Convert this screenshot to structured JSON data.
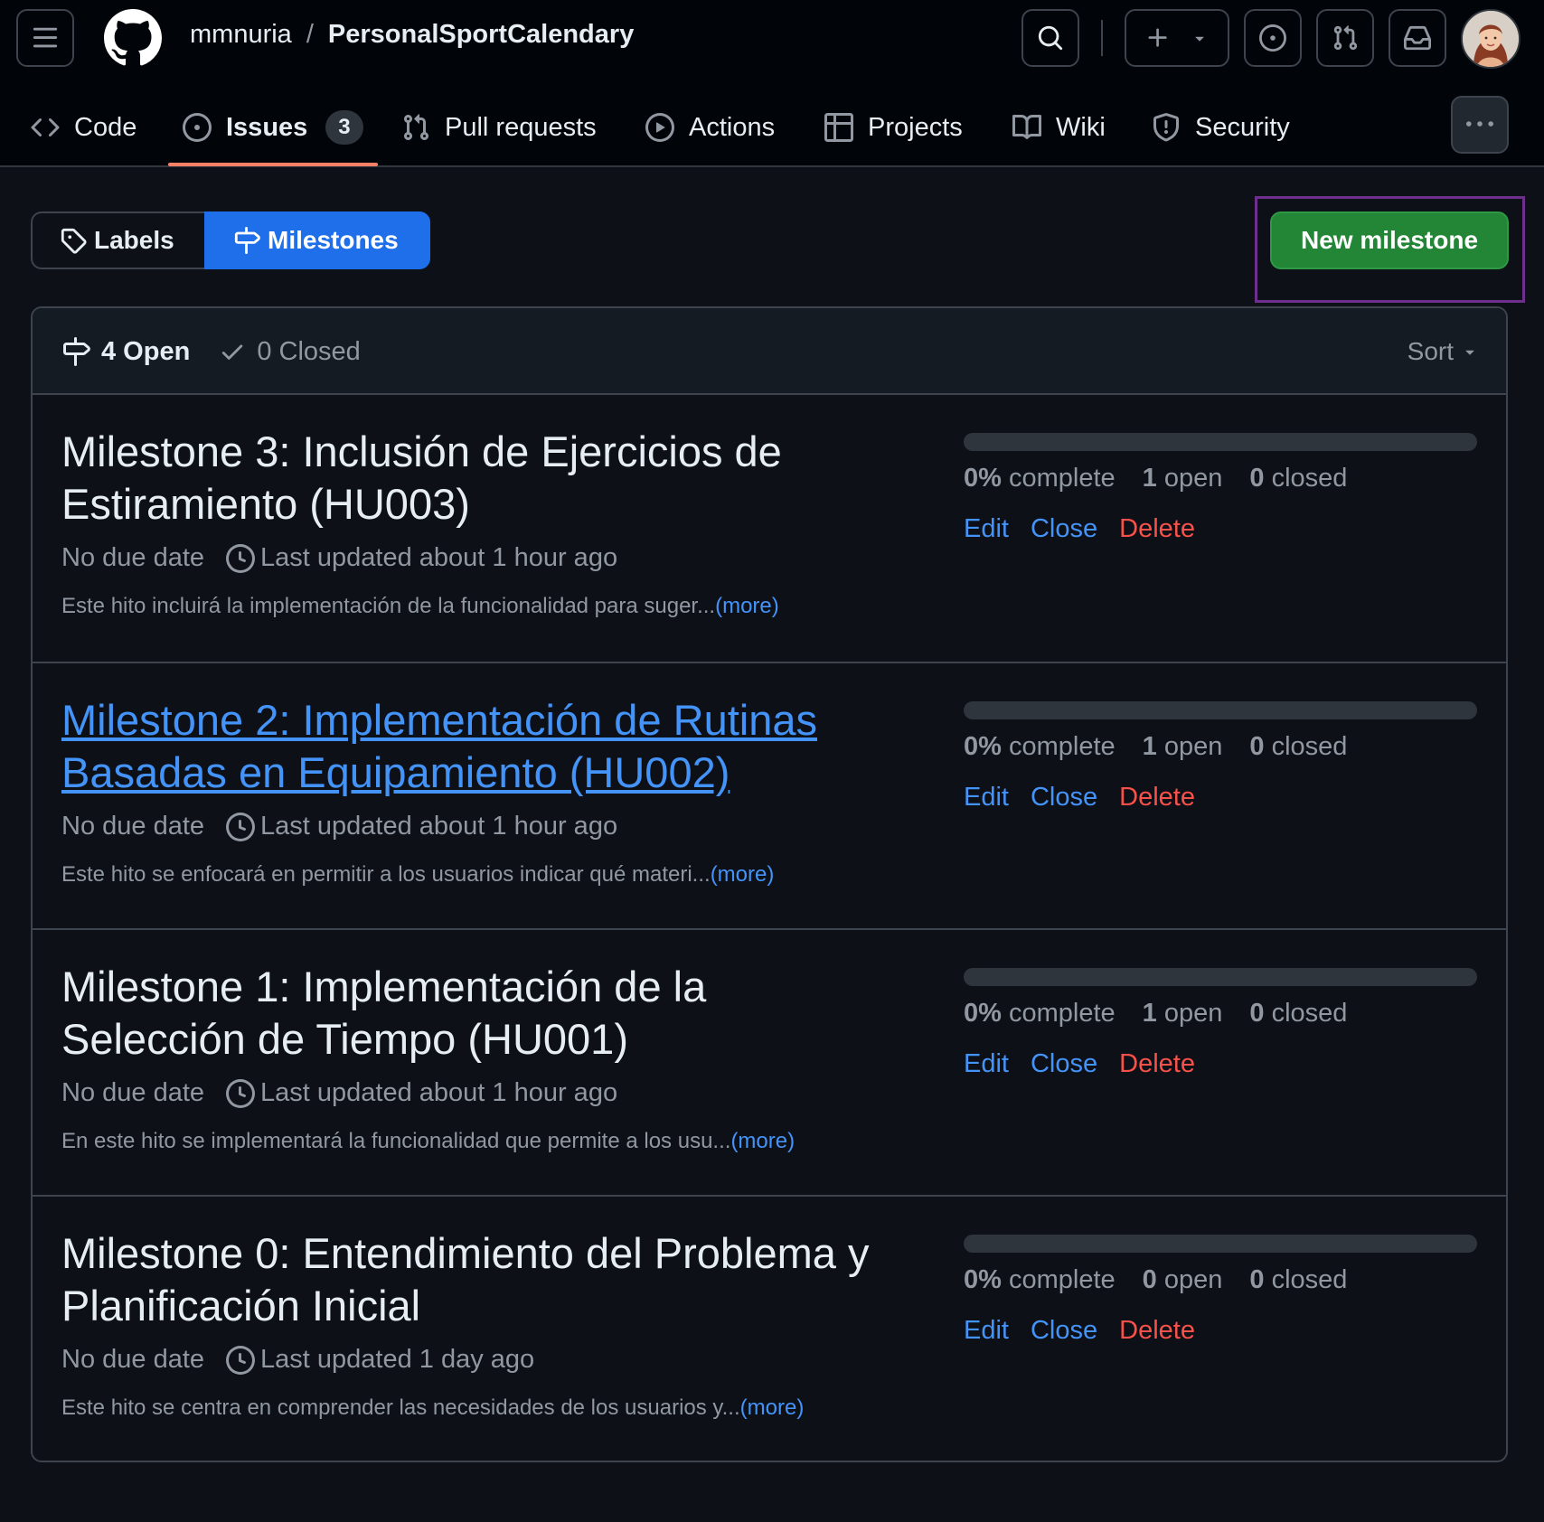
{
  "header": {
    "owner": "mmnuria",
    "separator": "/",
    "repo": "PersonalSportCalendary"
  },
  "repo_nav": {
    "items": [
      {
        "label": "Code",
        "icon": "code-icon"
      },
      {
        "label": "Issues",
        "icon": "issue-opened-icon",
        "counter": "3",
        "active": true
      },
      {
        "label": "Pull requests",
        "icon": "git-pull-request-icon"
      },
      {
        "label": "Actions",
        "icon": "play-icon"
      },
      {
        "label": "Projects",
        "icon": "table-icon"
      },
      {
        "label": "Wiki",
        "icon": "book-icon"
      },
      {
        "label": "Security",
        "icon": "shield-icon"
      }
    ]
  },
  "subnav": {
    "labels": "Labels",
    "milestones": "Milestones",
    "new_milestone": "New milestone"
  },
  "states": {
    "open": "4 Open",
    "closed": "0 Closed",
    "sort": "Sort"
  },
  "milestones": [
    {
      "title": "Milestone 3: Inclusión de Ejercicios de Estiramiento (HU003)",
      "due": "No due date",
      "updated": "Last updated about 1 hour ago",
      "description": "Este hito incluirá la implementación de la funcionalidad para suger...",
      "more": "(more)",
      "percent": "0%",
      "percent_label": "complete",
      "open_count": "1",
      "open_label": "open",
      "closed_count": "0",
      "closed_label": "closed",
      "progress": 0,
      "edit": "Edit",
      "close": "Close",
      "delete": "Delete"
    },
    {
      "title": "Milestone 2: Implementación de Rutinas Basadas en Equipamiento (HU002)",
      "due": "No due date",
      "updated": "Last updated about 1 hour ago",
      "description": "Este hito se enfocará en permitir a los usuarios indicar qué materi...",
      "more": "(more)",
      "percent": "0%",
      "percent_label": "complete",
      "open_count": "1",
      "open_label": "open",
      "closed_count": "0",
      "closed_label": "closed",
      "progress": 0,
      "edit": "Edit",
      "close": "Close",
      "delete": "Delete"
    },
    {
      "title": "Milestone 1: Implementación de la Selección de Tiempo (HU001)",
      "due": "No due date",
      "updated": "Last updated about 1 hour ago",
      "description": "En este hito se implementará la funcionalidad que permite a los usu...",
      "more": "(more)",
      "percent": "0%",
      "percent_label": "complete",
      "open_count": "1",
      "open_label": "open",
      "closed_count": "0",
      "closed_label": "closed",
      "progress": 0,
      "edit": "Edit",
      "close": "Close",
      "delete": "Delete"
    },
    {
      "title": "Milestone 0: Entendimiento del Problema y Planificación Inicial",
      "due": "No due date",
      "updated": "Last updated 1 day ago",
      "description": "Este hito se centra en comprender las necesidades de los usuarios y...",
      "more": "(more)",
      "percent": "0%",
      "percent_label": "complete",
      "open_count": "0",
      "open_label": "open",
      "closed_count": "0",
      "closed_label": "closed",
      "progress": 0,
      "edit": "Edit",
      "close": "Close",
      "delete": "Delete"
    }
  ],
  "colors": {
    "background": "#0d1117",
    "header_bg": "#010409",
    "accent_blue": "#1f6feb",
    "link_blue": "#4493f8",
    "green_button": "#238636",
    "danger_red": "#f85149",
    "active_tab_underline": "#f78166",
    "highlight_outline": "#6e2e8e"
  }
}
